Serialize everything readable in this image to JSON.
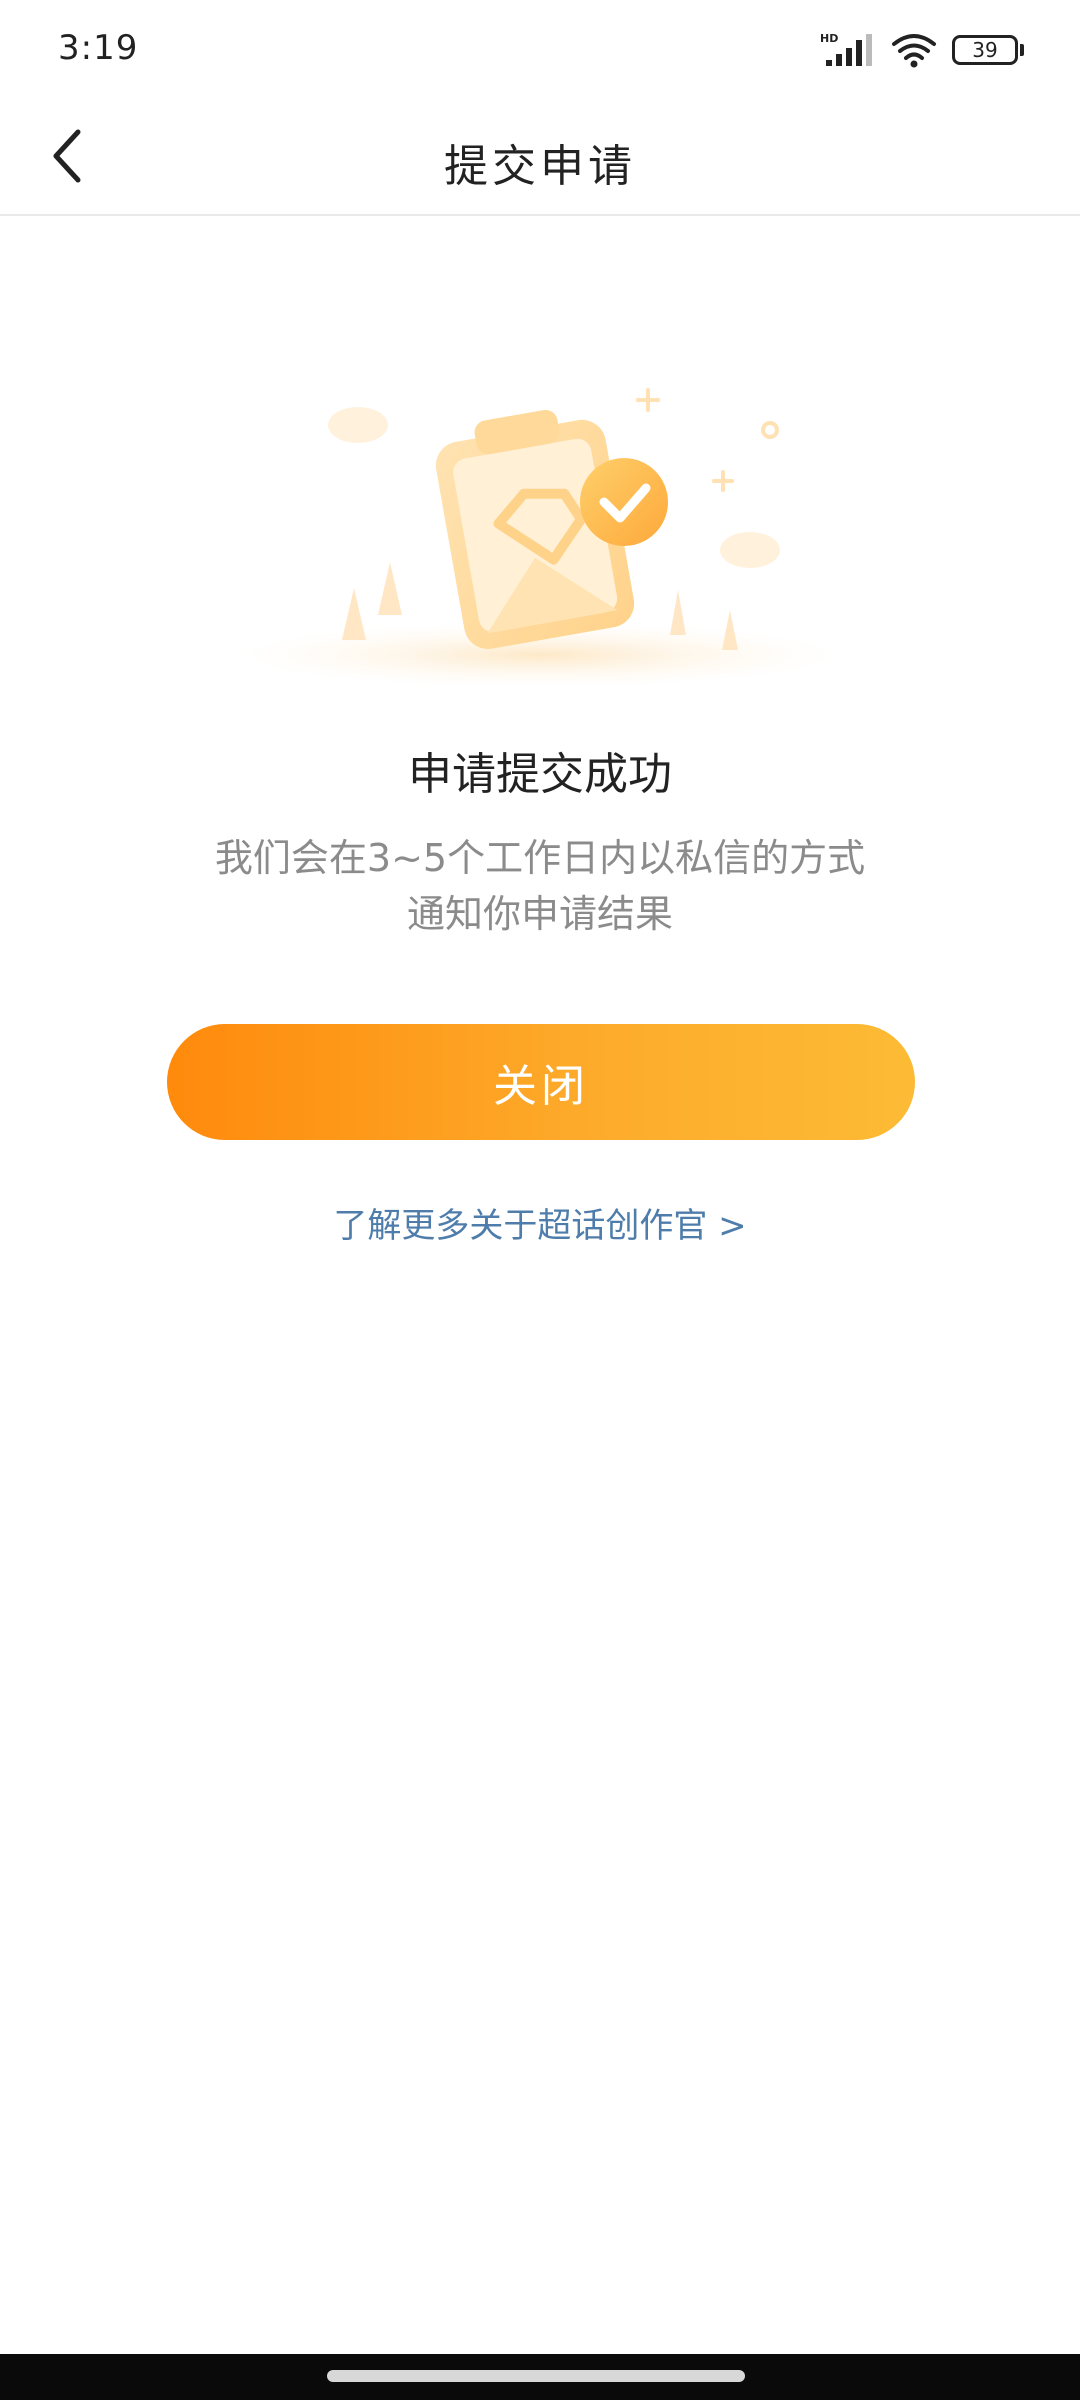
{
  "status_bar": {
    "time": "3:19",
    "network_badge": "HD",
    "battery_level": "39",
    "icons": [
      "signal-icon",
      "wifi-icon",
      "battery-icon"
    ]
  },
  "nav": {
    "title": "提交申请",
    "back_icon": "chevron-left-icon"
  },
  "content": {
    "illustration": "clipboard-check-illustration",
    "title": "申请提交成功",
    "description_line1": "我们会在3~5个工作日内以私信的方式",
    "description_line2": "通知你申请结果",
    "close_button_label": "关闭",
    "learn_more_link": "了解更多关于超话创作官 >"
  },
  "colors": {
    "accent_start": "#ff8a0c",
    "accent_end": "#fdbb35",
    "link": "#4f7dab",
    "muted_text": "#8b8b8b"
  }
}
